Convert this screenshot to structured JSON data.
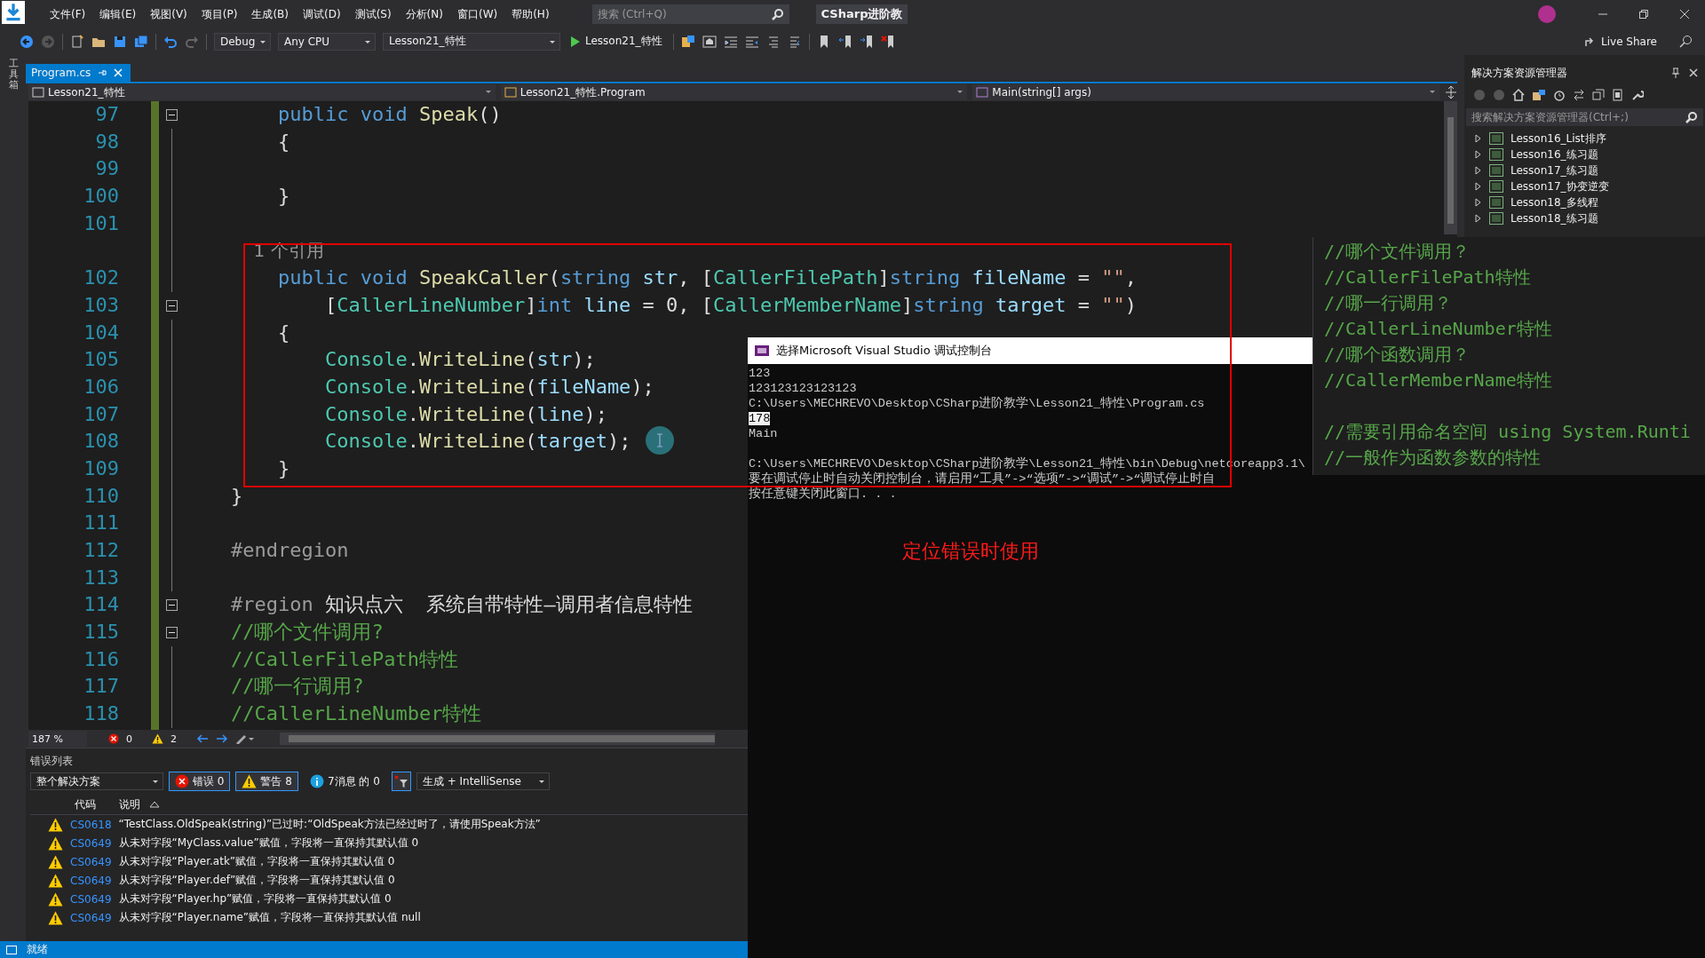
{
  "title_bar": {
    "menu": [
      "文件(F)",
      "编辑(E)",
      "视图(V)",
      "项目(P)",
      "生成(B)",
      "调试(D)",
      "测试(S)",
      "分析(N)",
      "窗口(W)",
      "帮助(H)"
    ],
    "search": {
      "placeholder": "搜索 (Ctrl+Q)"
    },
    "solution_name": "CSharp进阶教"
  },
  "toolbar": {
    "configuration": "Debug",
    "platform": "Any CPU",
    "startup_project": "Lesson21_特性",
    "run_label": "Lesson21_特性",
    "live_share": "Live Share"
  },
  "side_strip": {
    "label": "工具箱"
  },
  "editor": {
    "tab": {
      "label": "Program.cs",
      "selected": true
    },
    "nav": [
      "Lesson21_特性",
      "Lesson21_特性.Program",
      "Main(string[] args)"
    ],
    "lines": [
      {
        "number": "97",
        "foldable": true,
        "tokens": [
          {
            "kind": "kw",
            "text": "    public void "
          },
          {
            "kind": "method",
            "text": "Speak"
          },
          {
            "kind": "plain",
            "text": "()"
          }
        ]
      },
      {
        "number": "98",
        "foldable": false,
        "tokens": [
          {
            "kind": "plain",
            "text": "    {"
          }
        ]
      },
      {
        "number": "99",
        "foldable": false
      },
      {
        "number": "100",
        "foldable": false,
        "tokens": [
          {
            "kind": "plain",
            "text": "    }"
          }
        ]
      },
      {
        "number": "101",
        "foldable": false
      },
      {
        "foldable": false,
        "tokens": [
          {
            "kind": "lens",
            "text": "    1 个引用"
          }
        ]
      },
      {
        "number": "102",
        "foldable": false,
        "tokens": [
          {
            "kind": "kw",
            "text": "    public void "
          },
          {
            "kind": "method",
            "text": "SpeakCaller"
          },
          {
            "kind": "plain",
            "text": "("
          },
          {
            "kind": "kw",
            "text": "string "
          },
          {
            "kind": "param",
            "text": "str"
          },
          {
            "kind": "plain",
            "text": ", ["
          },
          {
            "kind": "attr",
            "text": "CallerFilePath"
          },
          {
            "kind": "plain",
            "text": "]"
          },
          {
            "kind": "kw",
            "text": "string "
          },
          {
            "kind": "param",
            "text": "fileName"
          },
          {
            "kind": "plain",
            "text": " = "
          },
          {
            "kind": "str",
            "text": "\"\""
          },
          {
            "kind": "plain",
            "text": ","
          }
        ]
      },
      {
        "number": "103",
        "foldable": true,
        "tokens": [
          {
            "kind": "plain",
            "text": "        ["
          },
          {
            "kind": "attr",
            "text": "CallerLineNumber"
          },
          {
            "kind": "plain",
            "text": "]"
          },
          {
            "kind": "kw",
            "text": "int "
          },
          {
            "kind": "param",
            "text": "line"
          },
          {
            "kind": "plain",
            "text": " = 0, ["
          },
          {
            "kind": "attr",
            "text": "CallerMemberName"
          },
          {
            "kind": "plain",
            "text": "]"
          },
          {
            "kind": "kw",
            "text": "string "
          },
          {
            "kind": "param",
            "text": "target"
          },
          {
            "kind": "plain",
            "text": " = "
          },
          {
            "kind": "str",
            "text": "\"\""
          },
          {
            "kind": "plain",
            "text": ")"
          }
        ]
      },
      {
        "number": "104",
        "foldable": false,
        "tokens": [
          {
            "kind": "plain",
            "text": "    {"
          }
        ]
      },
      {
        "number": "105",
        "foldable": false,
        "tokens": [
          {
            "kind": "type",
            "text": "        Console"
          },
          {
            "kind": "plain",
            "text": "."
          },
          {
            "kind": "method",
            "text": "WriteLine"
          },
          {
            "kind": "plain",
            "text": "("
          },
          {
            "kind": "param",
            "text": "str"
          },
          {
            "kind": "plain",
            "text": ");"
          }
        ]
      },
      {
        "number": "106",
        "foldable": false,
        "tokens": [
          {
            "kind": "type",
            "text": "        Console"
          },
          {
            "kind": "plain",
            "text": "."
          },
          {
            "kind": "method",
            "text": "WriteLine"
          },
          {
            "kind": "plain",
            "text": "("
          },
          {
            "kind": "param",
            "text": "fileName"
          },
          {
            "kind": "plain",
            "text": ");"
          }
        ]
      },
      {
        "number": "107",
        "foldable": false,
        "tokens": [
          {
            "kind": "type",
            "text": "        Console"
          },
          {
            "kind": "plain",
            "text": "."
          },
          {
            "kind": "method",
            "text": "WriteLine"
          },
          {
            "kind": "plain",
            "text": "("
          },
          {
            "kind": "param",
            "text": "line"
          },
          {
            "kind": "plain",
            "text": ");"
          }
        ]
      },
      {
        "number": "108",
        "foldable": false,
        "tokens": [
          {
            "kind": "type",
            "text": "        Console"
          },
          {
            "kind": "plain",
            "text": "."
          },
          {
            "kind": "method",
            "text": "WriteLine"
          },
          {
            "kind": "plain",
            "text": "("
          },
          {
            "kind": "param",
            "text": "target"
          },
          {
            "kind": "plain",
            "text": ");"
          }
        ]
      },
      {
        "number": "109",
        "foldable": false,
        "tokens": [
          {
            "kind": "plain",
            "text": "    }"
          }
        ]
      },
      {
        "number": "110",
        "foldable": false,
        "tokens": [
          {
            "kind": "plain",
            "text": "}"
          }
        ]
      },
      {
        "number": "111",
        "foldable": false
      },
      {
        "number": "112",
        "foldable": false,
        "tokens": [
          {
            "kind": "pre",
            "text": "#endregion"
          }
        ]
      },
      {
        "number": "113",
        "foldable": false
      },
      {
        "number": "114",
        "foldable": true,
        "tokens": [
          {
            "kind": "pre",
            "text": "#region "
          },
          {
            "kind": "plain",
            "text": "知识点六  系统自带特性—调用者信息特性"
          }
        ]
      },
      {
        "number": "115",
        "foldable": true,
        "tokens": [
          {
            "kind": "comment",
            "text": "//哪个文件调用?"
          }
        ]
      },
      {
        "number": "116",
        "foldable": false,
        "tokens": [
          {
            "kind": "comment",
            "text": "//CallerFilePath特性"
          }
        ]
      },
      {
        "number": "117",
        "foldable": false,
        "tokens": [
          {
            "kind": "comment",
            "text": "//哪一行调用?"
          }
        ]
      },
      {
        "number": "118",
        "foldable": false,
        "tokens": [
          {
            "kind": "comment",
            "text": "//CallerLineNumber特性"
          }
        ]
      }
    ],
    "zoom": "187 %",
    "errors": "0",
    "warnings": "2"
  },
  "solution_explorer": {
    "title": "解决方案资源管理器",
    "search": {
      "placeholder": "搜索解决方案资源管理器(Ctrl+;)"
    },
    "items": [
      {
        "label": "Lesson16_List排序",
        "expanded": false
      },
      {
        "label": "Lesson16_练习题",
        "expanded": false
      },
      {
        "label": "Lesson17_练习题",
        "expanded": false
      },
      {
        "label": "Lesson17_协变逆变",
        "expanded": false
      },
      {
        "label": "Lesson18_多线程",
        "expanded": false
      },
      {
        "label": "Lesson18_练习题",
        "expanded": false
      }
    ]
  },
  "error_list": {
    "title": "错误列表",
    "scope": "整个解决方案",
    "filters": [
      {
        "kind": "error",
        "label": "错误 0",
        "selected": true
      },
      {
        "kind": "warning",
        "label": "警告 8",
        "selected": true
      },
      {
        "kind": "message",
        "label": "7消息 的 0",
        "selected": false
      }
    ],
    "source": "生成 + IntelliSense",
    "columns": [
      "代码",
      "说明"
    ],
    "rows": [
      {
        "code": "CS0618",
        "description": "“TestClass.OldSpeak(string)”已过时:“OldSpeak方法已经过时了，请使用Speak方法”"
      },
      {
        "code": "CS0649",
        "description": "从未对字段“MyClass.value”赋值，字段将一直保持其默认值 0"
      },
      {
        "code": "CS0649",
        "description": "从未对字段“Player.atk”赋值，字段将一直保持其默认值 0"
      },
      {
        "code": "CS0649",
        "description": "从未对字段“Player.def”赋值，字段将一直保持其默认值 0"
      },
      {
        "code": "CS0649",
        "description": "从未对字段“Player.hp”赋值，字段将一直保持其默认值 0"
      },
      {
        "code": "CS0649",
        "description": "从未对字段“Player.name”赋值，字段将一直保持其默认值 null"
      }
    ]
  },
  "status_bar": {
    "text": "就绪"
  },
  "console": {
    "title": "选择Microsoft Visual Studio 调试控制台",
    "blocks": [
      [
        {
          "text": "123",
          "selected": false
        },
        {
          "text": "123123123123123",
          "selected": false
        },
        {
          "text": "C:\\Users\\MECHREVO\\Desktop\\CSharp进阶教学\\Lesson21_特性\\Program.cs",
          "selected": false
        },
        {
          "text": "178",
          "selected": true
        },
        {
          "text": "Main",
          "selected": false
        }
      ],
      [
        {
          "text": "C:\\Users\\MECHREVO\\Desktop\\CSharp进阶教学\\Lesson21_特性\\bin\\Debug\\netcoreapp3.1\\",
          "selected": false
        },
        {
          "text": "要在调试停止时自动关闭控制台，请启用“工具”->“选项”->“调试”->“调试停止时自",
          "selected": false
        },
        {
          "text": "按任意键关闭此窗口. . .",
          "selected": false
        }
      ]
    ]
  },
  "note_panel": {
    "blocks": [
      [
        "//哪个文件调用？",
        "//CallerFilePath特性",
        "//哪一行调用？",
        "//CallerLineNumber特性",
        "//哪个函数调用？",
        "//CallerMemberName特性"
      ],
      [
        "//需要引用命名空间 using System.Runti",
        "//一般作为函数参数的特性"
      ]
    ]
  },
  "annotation": {
    "text": "定位错误时使用"
  }
}
